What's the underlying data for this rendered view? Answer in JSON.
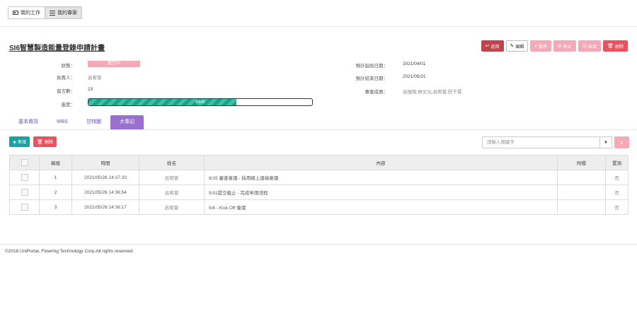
{
  "topnav": {
    "my_work": "我的工作",
    "my_projects": "我的專案"
  },
  "project": {
    "title": "SI6智慧製造能量登錄申請計畫"
  },
  "actions": {
    "back": "返回",
    "edit": "編輯",
    "pause": "暫停",
    "stop": "終止",
    "finish": "結束",
    "delete": "刪除"
  },
  "fields": {
    "status_label": "狀態：",
    "status_value": "進行中",
    "owner_label": "負責人：",
    "owner_value": "呂宥萱",
    "comments_label": "留言數：",
    "comments_value": "23",
    "progress_label": "進度：",
    "progress_value": 66,
    "progress_text": "66%",
    "start_label": "預計起始日期：",
    "start_value": "2021/04/01",
    "end_label": "預計結束日期：",
    "end_value": "2021/05/31",
    "members_label": "專案成員：",
    "members_value": "呂振銘;林文元;呂宥萱;莊千慧"
  },
  "tabs": [
    "基本資訊",
    "WBS",
    "甘特圖",
    "大事記"
  ],
  "toolbar": {
    "add": "新增",
    "delete": "刪除",
    "search_placeholder": "請輸入關鍵字"
  },
  "table": {
    "headers": [
      "",
      "編號",
      "時間",
      "姓名",
      "內容",
      "附檔",
      "置頂"
    ],
    "rows": [
      {
        "no": "1",
        "time": "2021/05/26 14:37:20",
        "name": "呂宥萱",
        "content": "6/15 審查會議 - 採用線上遠端會議",
        "attachment": "",
        "pinned": "否"
      },
      {
        "no": "2",
        "time": "2021/05/26 14:36:54",
        "name": "呂宥萱",
        "content": "5/31提交截止 - 完成申請流程",
        "attachment": "",
        "pinned": "否"
      },
      {
        "no": "3",
        "time": "2021/05/26 14:36:17",
        "name": "呂宥萱",
        "content": "5/4 - Kick Off 會議",
        "attachment": "",
        "pinned": "否"
      }
    ]
  },
  "footer": {
    "copyright": "©2018 UniPortal. Flowring Technology Corp.All rights reserved."
  },
  "colors": {
    "accent_purple": "#9b6fd0",
    "teal": "#17a2a3",
    "pink": "#f4a9b6",
    "danger": "#e8535f",
    "back": "#c0444a"
  },
  "icons": {
    "my_work": "id-card-icon",
    "my_projects": "list-icon",
    "back": "reply-icon",
    "edit": "pencil-icon",
    "pause": "pause-icon",
    "stop": "ban-icon",
    "finish": "check-square-icon",
    "delete": "trash-icon",
    "add": "plus-icon",
    "search": "search-icon",
    "caret": "caret-down-icon"
  }
}
